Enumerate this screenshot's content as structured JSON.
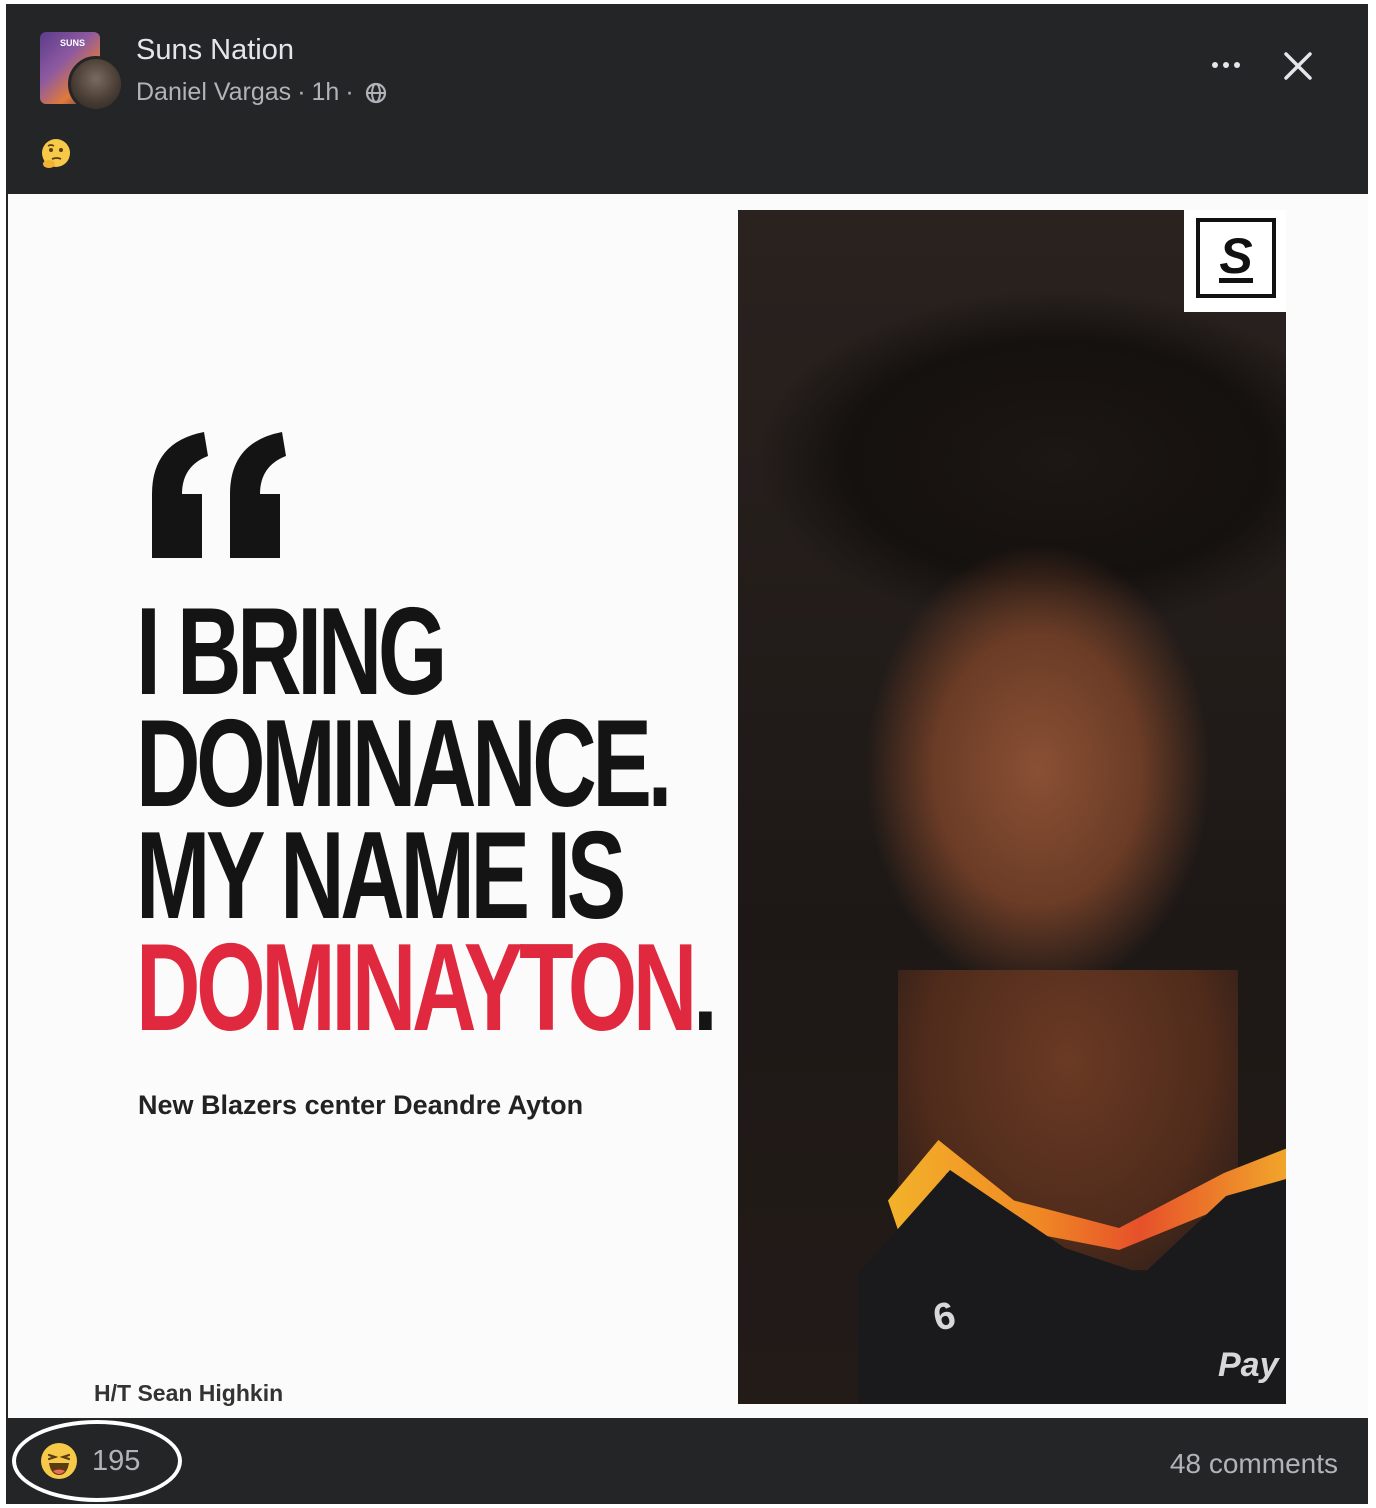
{
  "post": {
    "group_name": "Suns Nation",
    "author": "Daniel Vargas",
    "time": "1h",
    "separator": "·",
    "body_emoji_icon": "thinking-face-icon",
    "privacy_icon": "globe-icon"
  },
  "image": {
    "headline_line1": "I BRING",
    "headline_line2": "DOMINANCE.",
    "headline_line3": "MY NAME IS",
    "headline_line4_red": "DOMINAYTON",
    "headline_line4_end": ".",
    "caption": "New Blazers center Deandre Ayton",
    "credit": "H/T Sean Highkin",
    "logo_letter": "S",
    "jersey_number": "6",
    "jersey_sponsor": "Pay",
    "accent_red": "#e0293f"
  },
  "footer": {
    "reaction_icon": "haha-icon",
    "reaction_count": "195",
    "comments": "48 comments"
  },
  "colors": {
    "background": "#242526",
    "primary_text": "#e4e6eb",
    "secondary_text": "#b0b3b8"
  }
}
